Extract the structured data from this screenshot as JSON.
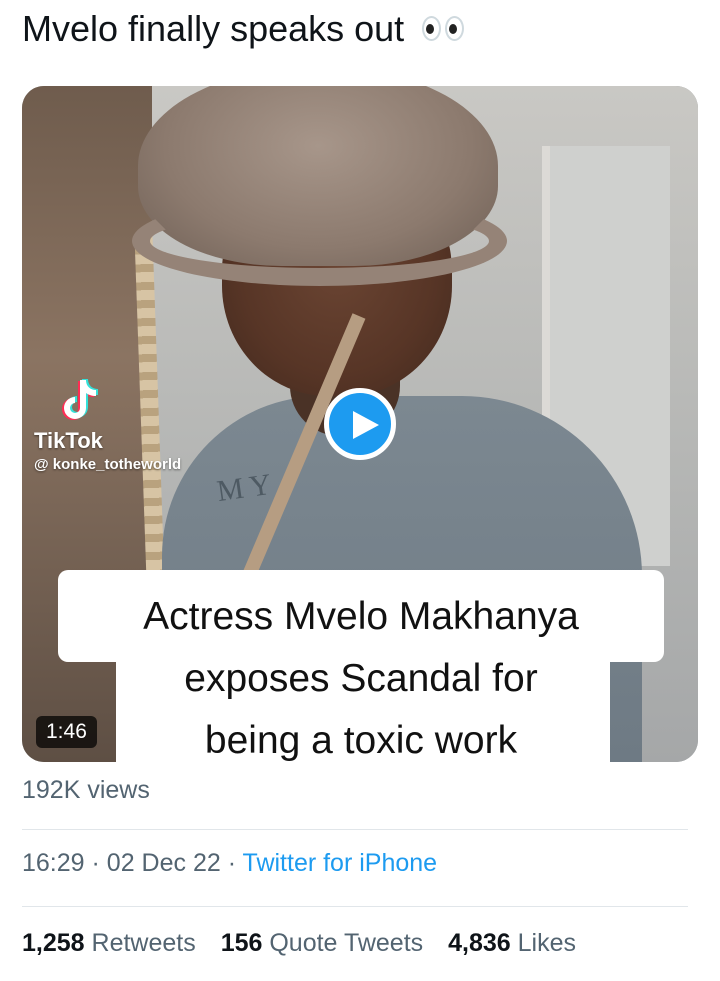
{
  "tweet": {
    "text": "Mvelo finally speaks out",
    "emoji": "eyes-emoji"
  },
  "video": {
    "tiktok_brand": "TikTok",
    "tiktok_handle": "@ konke_totheworld",
    "shirt_print": "MY",
    "caption_lines": [
      "Actress Mvelo Makhanya",
      "exposes Scandal for",
      "being a toxic work"
    ],
    "duration": "1:46",
    "play_icon": "play-icon"
  },
  "views": "192K views",
  "meta": {
    "time": "16:29",
    "separator": "·",
    "date": "02 Dec 22",
    "source": "Twitter for iPhone"
  },
  "stats": {
    "retweets_count": "1,258",
    "retweets_label": "Retweets",
    "quotes_count": "156",
    "quotes_label": "Quote Tweets",
    "likes_count": "4,836",
    "likes_label": "Likes"
  },
  "colors": {
    "accent": "#1d9bf0",
    "secondary_text": "#536471",
    "primary_text": "#0f1419"
  }
}
